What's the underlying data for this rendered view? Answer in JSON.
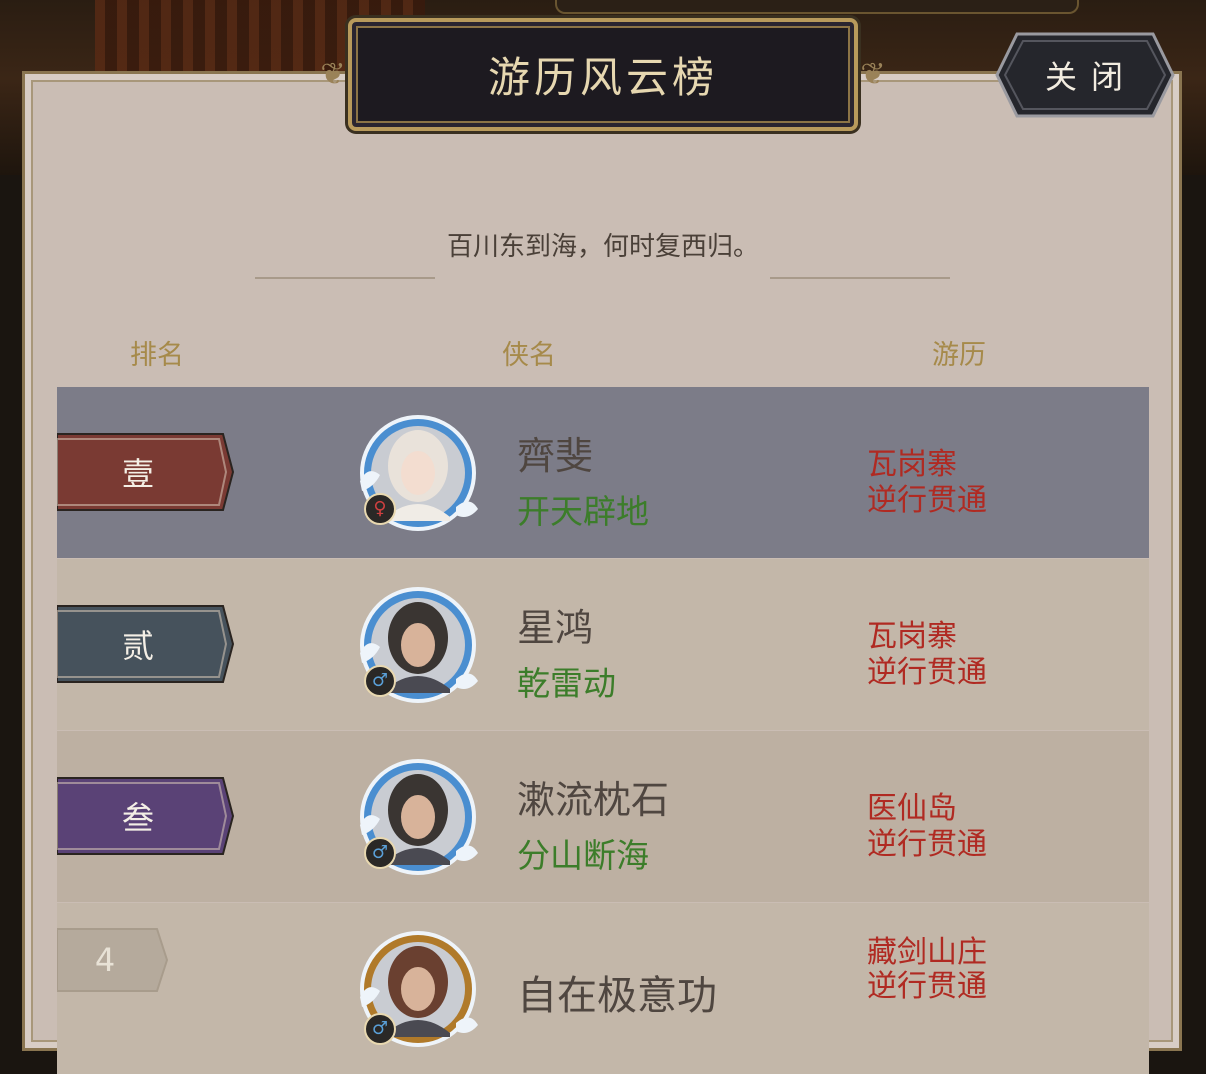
{
  "panel": {
    "title": "游历风云榜",
    "close_label": "关闭",
    "subtitle": "百川东到海，何时复西归。"
  },
  "headers": {
    "rank": "排名",
    "hero_name": "侠名",
    "travel": "游历"
  },
  "rows": [
    {
      "rank": "壹",
      "name": "齊斐",
      "skill": "开天辟地",
      "location": "瓦岗寨",
      "status": "逆行贯通",
      "gender": "♀",
      "badge_color": "#7a3a33",
      "row_color": "#7c7c88"
    },
    {
      "rank": "贰",
      "name": "星鸿",
      "skill": "乾雷动",
      "location": "瓦岗寨",
      "status": "逆行贯通",
      "gender": "♂",
      "badge_color": "#46525c",
      "row_color": "#c3b7a9"
    },
    {
      "rank": "叁",
      "name": "漱流枕石",
      "skill": "分山断海",
      "location": "医仙岛",
      "status": "逆行贯通",
      "gender": "♂",
      "badge_color": "#5a4276",
      "row_color": "#bdb0a2"
    },
    {
      "rank": "4",
      "name": "自在极意功",
      "skill": "",
      "location": "藏剑山庄",
      "status": "逆行贯通",
      "gender": "♂",
      "badge_color": "#b5aa9c",
      "row_color": "#c3b7a9"
    }
  ]
}
